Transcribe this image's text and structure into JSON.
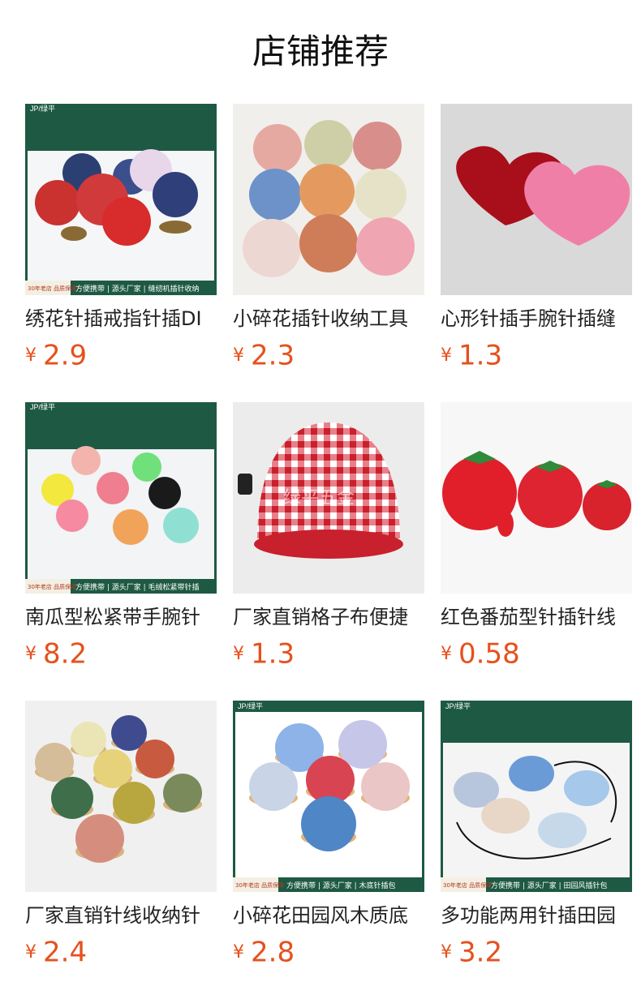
{
  "header": {
    "title": "店铺推荐"
  },
  "currency_symbol": "¥",
  "products": [
    {
      "name": "绣花针插戒指针插DI",
      "price": "2.9",
      "tag": "JP/绿平",
      "badge": "30年老店 品质保障",
      "banner": "方便携带 | 源头厂家 | 缝纫机插针收纳"
    },
    {
      "name": "小碎花插针收纳工具",
      "price": "2.3"
    },
    {
      "name": "心形针插手腕针插缝",
      "price": "1.3"
    },
    {
      "name": "南瓜型松紧带手腕针",
      "price": "8.2",
      "tag": "JP/绿平",
      "badge": "30年老店 品质保障",
      "banner": "方便携带 | 源头厂家 | 毛绒松紧带针插"
    },
    {
      "name": "厂家直销格子布便捷",
      "price": "1.3",
      "watermark": "绿平五金"
    },
    {
      "name": "红色番茄型针插针线",
      "price": "0.58"
    },
    {
      "name": "厂家直销针线收纳针",
      "price": "2.4"
    },
    {
      "name": "小碎花田园风木质底",
      "price": "2.8",
      "tag": "JP/绿平",
      "badge": "30年老店 品质保障",
      "banner": "方便携带 | 源头厂家 | 木底针插包"
    },
    {
      "name": "多功能两用针插田园",
      "price": "3.2",
      "tag": "JP/绿平",
      "badge": "30年老店 品质保障",
      "banner": "方便携带 | 源头厂家 | 田园风插针包"
    }
  ]
}
